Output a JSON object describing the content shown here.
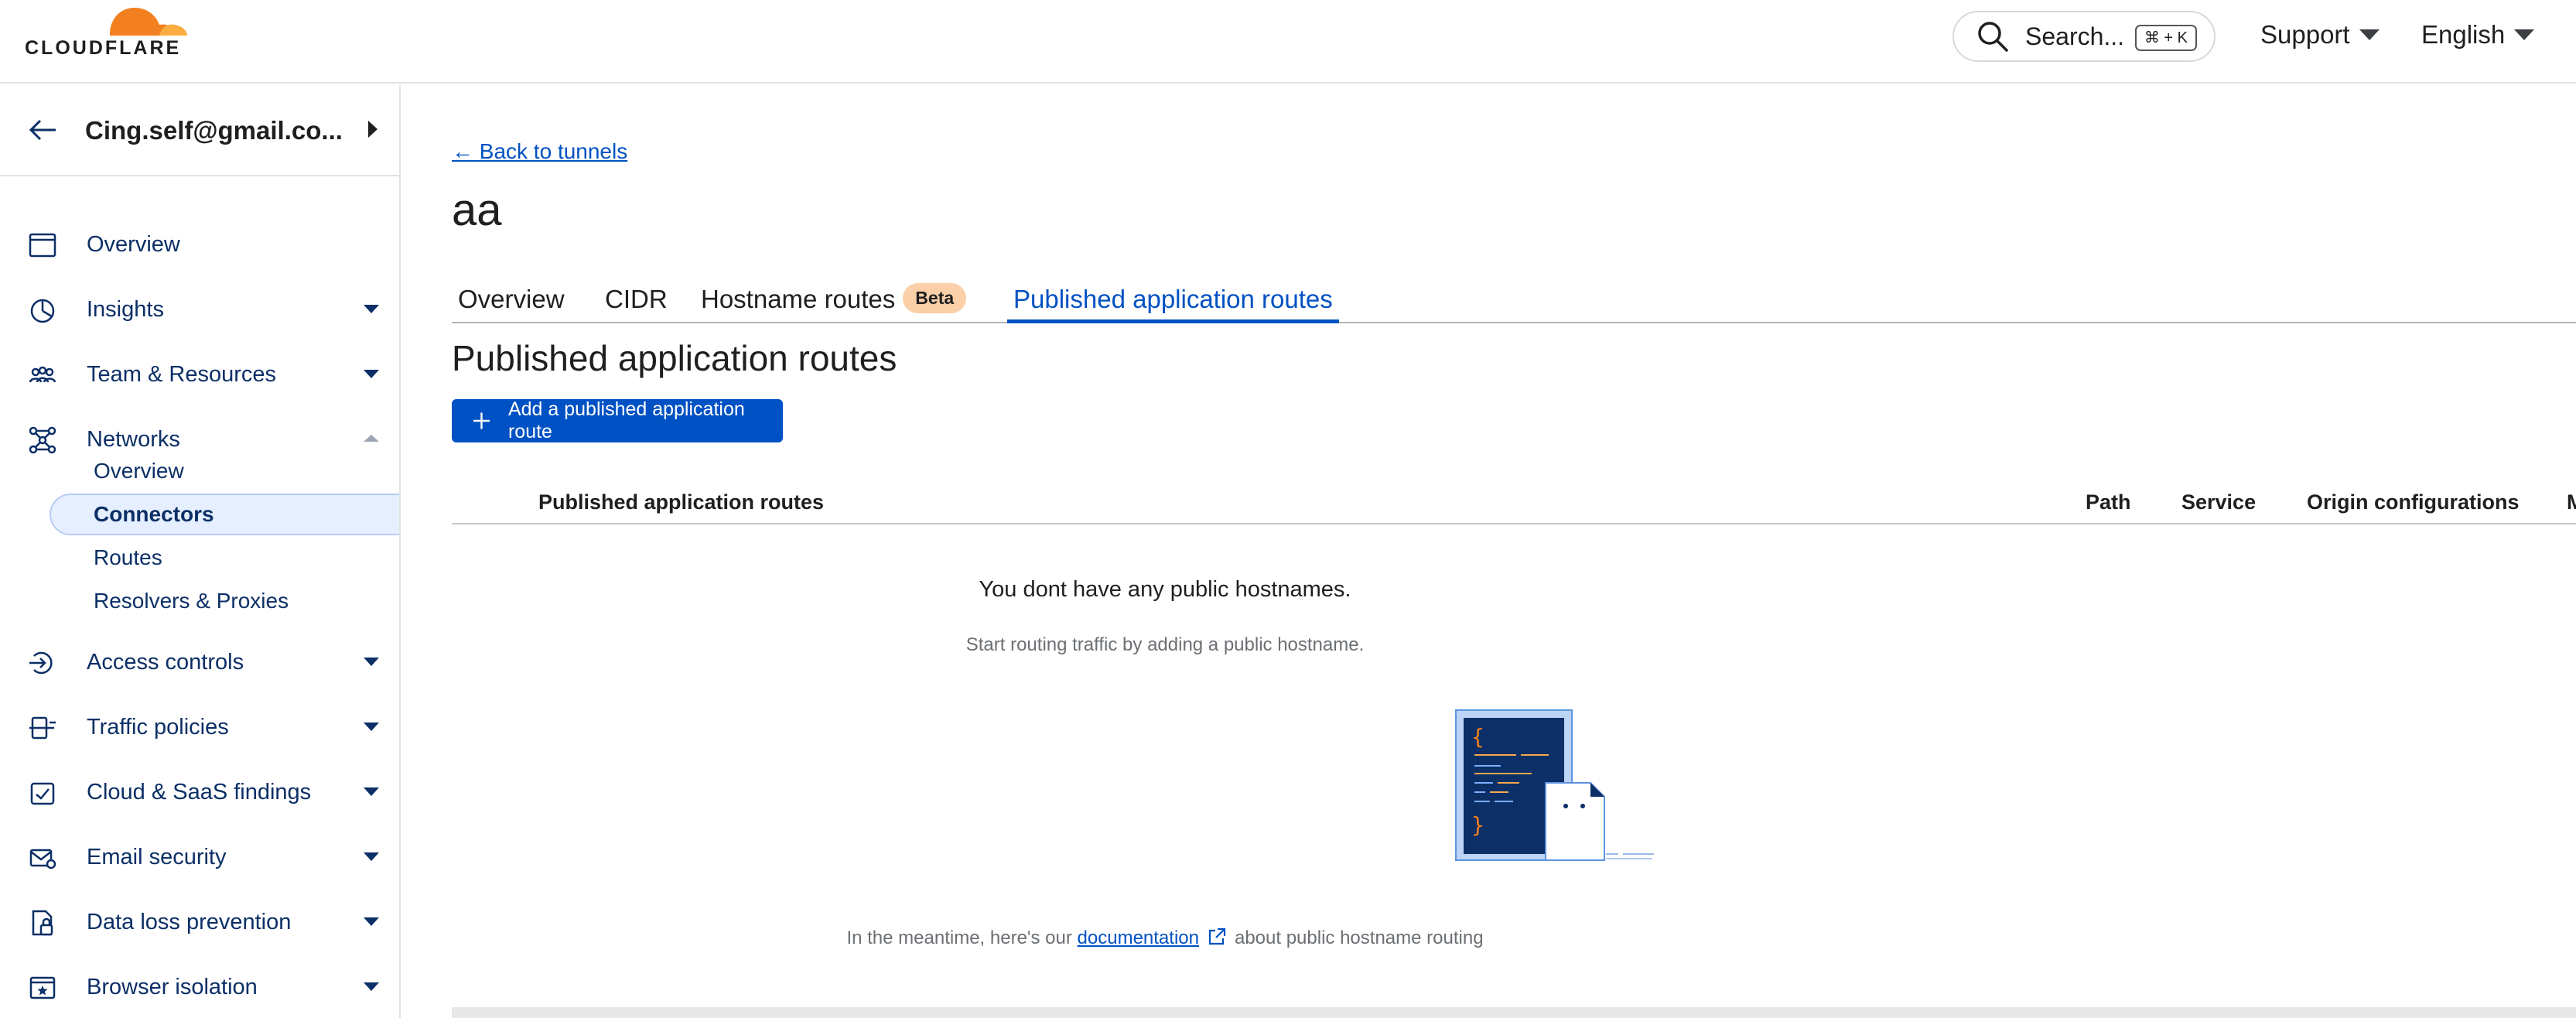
{
  "header": {
    "logo_text": "CLOUDFLARE",
    "search_placeholder": "Search...",
    "search_shortcut": "⌘ + K",
    "support_label": "Support",
    "language_label": "English"
  },
  "sidebar": {
    "account_name": "Cing.self@gmail.co...",
    "items": [
      {
        "label": "Overview",
        "icon": "browser-window-icon",
        "chevron": "none"
      },
      {
        "label": "Insights",
        "icon": "pie-chart-icon",
        "chevron": "down"
      },
      {
        "label": "Team & Resources",
        "icon": "team-icon",
        "chevron": "down"
      },
      {
        "label": "Networks",
        "icon": "network-icon",
        "chevron": "up"
      },
      {
        "label": "Access controls",
        "icon": "access-controls-icon",
        "chevron": "down"
      },
      {
        "label": "Traffic policies",
        "icon": "traffic-policies-icon",
        "chevron": "down"
      },
      {
        "label": "Cloud & SaaS findings",
        "icon": "cloud-saas-icon",
        "chevron": "down"
      },
      {
        "label": "Email security",
        "icon": "email-security-icon",
        "chevron": "down"
      },
      {
        "label": "Data loss prevention",
        "icon": "data-loss-icon",
        "chevron": "down"
      },
      {
        "label": "Browser isolation",
        "icon": "browser-isolation-icon",
        "chevron": "down"
      }
    ],
    "networks_sub": [
      "Overview",
      "Connectors",
      "Routes",
      "Resolvers & Proxies"
    ],
    "active_sub": "Connectors"
  },
  "main": {
    "back_link": "← Back to tunnels",
    "title": "aa",
    "tabs": [
      {
        "label": "Overview",
        "active": false
      },
      {
        "label": "CIDR",
        "active": false
      },
      {
        "label": "Hostname routes",
        "badge": "Beta",
        "active": false
      },
      {
        "label": "Published application routes",
        "active": true
      }
    ],
    "section_title": "Published application routes",
    "add_button": "Add a published application route",
    "table_headers": [
      "Published application routes",
      "Path",
      "Service",
      "Origin configurations",
      "Menu"
    ],
    "empty_title": "You dont have any public hostnames.",
    "empty_subtitle": "Start routing traffic by adding a public hostname.",
    "meantime_prefix": "In the meantime, here's our",
    "meantime_link": "documentation",
    "meantime_suffix": "about public hostname routing"
  },
  "colors": {
    "accent": "#0051c3",
    "nav_text": "#0b2f66",
    "logo_orange": "#f38020",
    "beta_badge": "#fbcfa8"
  }
}
